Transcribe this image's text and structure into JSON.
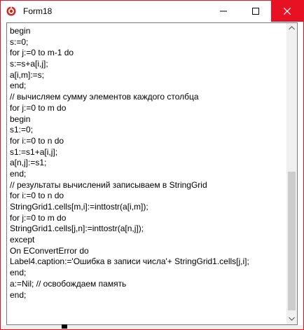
{
  "window": {
    "title": "Form18",
    "accent_color": "#e81123",
    "icon": "delphi-app-icon",
    "controls": {
      "minimize_icon": "minimize-icon",
      "maximize_icon": "maximize-icon",
      "close_icon": "close-icon"
    }
  },
  "memo": {
    "lines": [
      "begin",
      "s:=0;",
      "for j:=0 to m-1 do",
      "s:=s+a[i,j];",
      "a[i,m]:=s;",
      "end;",
      "// вычисляем сумму элементов каждого столбца",
      "for j:=0 to m do",
      "begin",
      "s1:=0;",
      "for i:=0 to n do",
      "s1:=s1+a[i,j];",
      "a[n,j]:=s1;",
      "end;",
      "// результаты вычислений записываем в StringGrid",
      "for i:=0 to n do",
      "StringGrid1.cells[m,i]:=inttostr(a[i,m]);",
      "for j:=0 to m do",
      "StringGrid1.cells[j,n]:=inttostr(a[n,j]);",
      "except",
      "On EConvertError do",
      "Label4.caption:='Ошибка в записи числа'+ StringGrid1.cells[j,i];",
      "end;",
      "a:=Nil; // освобождаем память",
      "end;"
    ]
  },
  "scrollbar": {
    "position_fraction": 0.5
  }
}
